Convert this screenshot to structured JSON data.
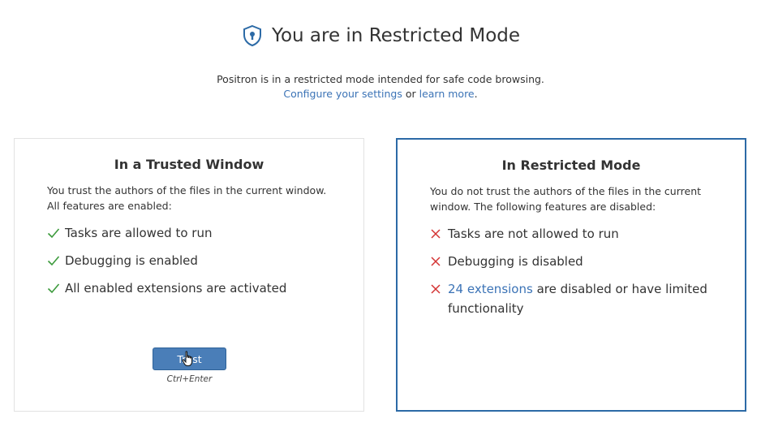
{
  "header": {
    "title": "You are in Restricted Mode",
    "icon": "shield-keyhole-icon"
  },
  "subtitle": {
    "text": "Positron is in a restricted mode intended for safe code browsing.",
    "link_settings": "Configure your settings",
    "connector": "or",
    "link_learn": "learn more",
    "period": "."
  },
  "trusted": {
    "title": "In a Trusted Window",
    "description": "You trust the authors of the files in the current window. All features are enabled:",
    "features": [
      {
        "text": "Tasks are allowed to run"
      },
      {
        "text": "Debugging is enabled"
      },
      {
        "text": "All enabled extensions are activated"
      }
    ],
    "button_label": "Trust",
    "shortcut": "Ctrl+Enter"
  },
  "restricted": {
    "title": "In Restricted Mode",
    "description": "You do not trust the authors of the files in the current window. The following features are disabled:",
    "features": [
      {
        "text": "Tasks are not allowed to run"
      },
      {
        "text": "Debugging is disabled"
      },
      {
        "link": "24 extensions",
        "text": " are disabled or have limited functionality"
      }
    ]
  },
  "colors": {
    "accent": "#2c6aa6",
    "link": "#3b73b6",
    "check": "#3c9a3c",
    "cross": "#d33333",
    "button": "#4a7eb8"
  }
}
